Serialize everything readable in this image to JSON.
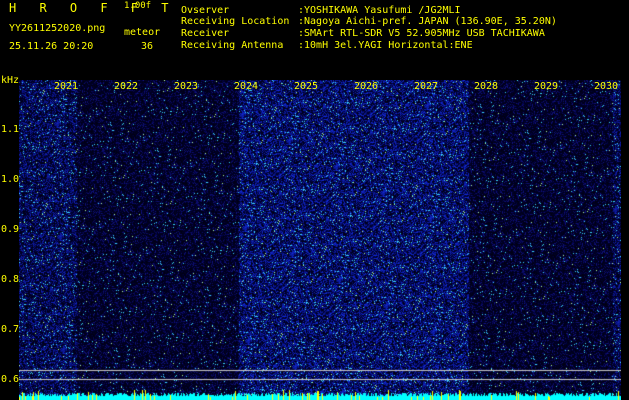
{
  "header": {
    "app_name": "H R O F F T",
    "version": "1.00f",
    "filename": "YY2611252020.png",
    "mode": "meteor",
    "datetime": "25.11.26 20:20",
    "count": "36",
    "info": [
      {
        "key": "Ovserver",
        "value": ":YOSHIKAWA Yasufumi /JG2MLI"
      },
      {
        "key": "Receiving Location",
        "value": ":Nagoya Aichi-pref. JAPAN (136.90E, 35.20N)"
      },
      {
        "key": "Receiver",
        "value": ":SMArt RTL-SDR V5 52.905MHz USB TACHIKAWA"
      },
      {
        "key": "Receiving Antenna",
        "value": ":10mH 3el.YAGI Horizontal:ENE"
      }
    ]
  },
  "axis": {
    "unit": "kHz",
    "y_ticks": [
      "1.1",
      "1.0",
      "0.9",
      "0.8",
      "0.7",
      "0.6"
    ],
    "x_ticks": [
      "2021",
      "2022",
      "2023",
      "2024",
      "2025",
      "2026",
      "2027",
      "2028",
      "2029",
      "2030"
    ]
  },
  "colors": {
    "text": "#ffff00",
    "background": "#000000",
    "spectrum_low": "#0a1a6e",
    "spectrum_high": "#2a56ff",
    "baseline": "#00ffff",
    "reference_line": "#c8c8c8"
  }
}
